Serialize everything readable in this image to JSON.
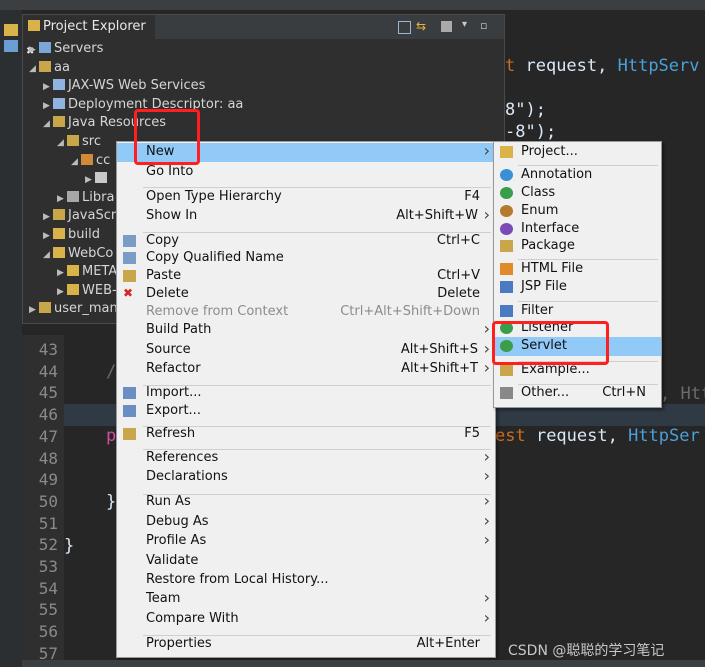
{
  "explorer": {
    "tab_title": "Project Explorer",
    "tab_close": "✖",
    "tree": [
      {
        "label": "Servers",
        "indent": 0,
        "twisty": "▶"
      },
      {
        "label": "aa",
        "indent": 0,
        "twisty": "◢"
      },
      {
        "label": "JAX-WS Web Services",
        "indent": 1,
        "twisty": "▶"
      },
      {
        "label": "Deployment Descriptor: aa",
        "indent": 1,
        "twisty": "▶"
      },
      {
        "label": "Java Resources",
        "indent": 1,
        "twisty": "◢"
      },
      {
        "label": "src",
        "indent": 2,
        "twisty": "◢"
      },
      {
        "label": "cc",
        "indent": 3,
        "twisty": "◢"
      },
      {
        "label": "",
        "indent": 4,
        "twisty": "▶"
      },
      {
        "label": "Libra",
        "indent": 2,
        "twisty": "▶"
      },
      {
        "label": "JavaScri",
        "indent": 1,
        "twisty": "▶"
      },
      {
        "label": "build",
        "indent": 1,
        "twisty": "▶"
      },
      {
        "label": "WebCo",
        "indent": 1,
        "twisty": "◢"
      },
      {
        "label": "META",
        "indent": 2,
        "twisty": "▶"
      },
      {
        "label": "WEB-",
        "indent": 2,
        "twisty": "▶"
      },
      {
        "label": "user_mana",
        "indent": 0,
        "twisty": "▶"
      }
    ]
  },
  "editor": {
    "lines": [
      "43",
      "44",
      "45",
      "46",
      "47",
      "48",
      "49",
      "50",
      "51",
      "52",
      "53",
      "54",
      "55",
      "56",
      "57"
    ],
    "frag1_a": "t ",
    "frag1_b": "request, ",
    "frag1_c": "HttpServ",
    "frag2": "8\");",
    "frag3": "-8\");",
    "frag4": ", Htt",
    "frag5_a": "est ",
    "frag5_b": "request, ",
    "frag5_c": "HttpSer",
    "frag_p": "p",
    "frag_slash": "/",
    "frag_brace1": "}",
    "frag_brace2": "}"
  },
  "context_menu": {
    "items": [
      {
        "label": "New",
        "shortcut": "",
        "arrow": true,
        "selected": true
      },
      {
        "label": "Go Into",
        "shortcut": "",
        "arrow": false
      },
      {
        "sep": true
      },
      {
        "label": "Open Type Hierarchy",
        "shortcut": "F4",
        "arrow": false
      },
      {
        "label": "Show In",
        "shortcut": "Alt+Shift+W",
        "arrow": true
      },
      {
        "sep": true
      },
      {
        "label": "Copy",
        "shortcut": "Ctrl+C",
        "icon": "copy-icon"
      },
      {
        "label": "Copy Qualified Name",
        "shortcut": "",
        "icon": "copy-icon"
      },
      {
        "label": "Paste",
        "shortcut": "Ctrl+V",
        "icon": "paste-icon"
      },
      {
        "label": "Delete",
        "shortcut": "Delete",
        "icon": "delete-icon"
      },
      {
        "label": "Remove from Context",
        "shortcut": "Ctrl+Alt+Shift+Down",
        "disabled": true
      },
      {
        "label": "Build Path",
        "shortcut": "",
        "arrow": true
      },
      {
        "label": "Source",
        "shortcut": "Alt+Shift+S",
        "arrow": true
      },
      {
        "label": "Refactor",
        "shortcut": "Alt+Shift+T",
        "arrow": true
      },
      {
        "sep": true
      },
      {
        "label": "Import...",
        "shortcut": "",
        "icon": "import-icon"
      },
      {
        "label": "Export...",
        "shortcut": "",
        "icon": "export-icon"
      },
      {
        "sep": true
      },
      {
        "label": "Refresh",
        "shortcut": "F5",
        "icon": "refresh-icon"
      },
      {
        "sep": true
      },
      {
        "label": "References",
        "shortcut": "",
        "arrow": true
      },
      {
        "label": "Declarations",
        "shortcut": "",
        "arrow": true
      },
      {
        "sep": true
      },
      {
        "label": "Run As",
        "shortcut": "",
        "arrow": true
      },
      {
        "label": "Debug As",
        "shortcut": "",
        "arrow": true
      },
      {
        "label": "Profile As",
        "shortcut": "",
        "arrow": true
      },
      {
        "label": "Validate",
        "shortcut": ""
      },
      {
        "label": "Restore from Local History...",
        "shortcut": ""
      },
      {
        "label": "Team",
        "shortcut": "",
        "arrow": true
      },
      {
        "label": "Compare With",
        "shortcut": "",
        "arrow": true
      },
      {
        "sep": true
      },
      {
        "label": "Properties",
        "shortcut": "Alt+Enter"
      }
    ]
  },
  "new_submenu": {
    "items": [
      {
        "label": "Project...",
        "icon": "project-icon"
      },
      {
        "sep": true
      },
      {
        "label": "Annotation",
        "icon": "annotation-icon"
      },
      {
        "label": "Class",
        "icon": "class-icon"
      },
      {
        "label": "Enum",
        "icon": "enum-icon"
      },
      {
        "label": "Interface",
        "icon": "interface-icon"
      },
      {
        "label": "Package",
        "icon": "package-icon"
      },
      {
        "sep": true
      },
      {
        "label": "HTML File",
        "icon": "html-file-icon"
      },
      {
        "label": "JSP File",
        "icon": "jsp-file-icon"
      },
      {
        "sep": true
      },
      {
        "label": "Filter",
        "icon": "filter-icon"
      },
      {
        "label": "Listener",
        "icon": "listener-icon"
      },
      {
        "label": "Servlet",
        "icon": "servlet-icon",
        "selected": true
      },
      {
        "sep": true
      },
      {
        "label": "Example...",
        "icon": "example-icon"
      },
      {
        "sep": true
      },
      {
        "label": "Other...",
        "shortcut": "Ctrl+N",
        "icon": "other-icon"
      }
    ]
  },
  "watermark": "CSDN @聪聪的学习笔记",
  "colors": {
    "highlight": "#91c9f7",
    "annotation_red": "#ff1f1f"
  }
}
